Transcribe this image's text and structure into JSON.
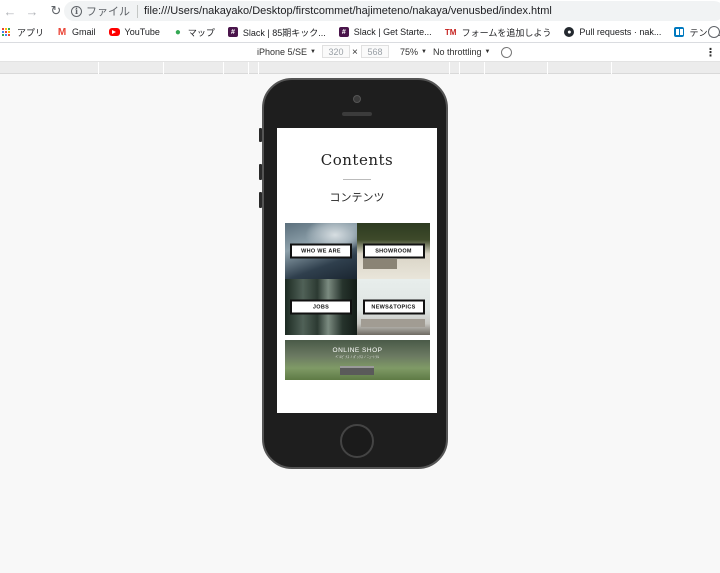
{
  "browser": {
    "scheme_label": "ファイル",
    "url": "file:///Users/nakayako/Desktop/firstcommet/hajimeteno/nakaya/venusbed/index.html"
  },
  "bookmarks": [
    {
      "label": "アプリ",
      "icon": "apps-grid-icon"
    },
    {
      "label": "Gmail",
      "icon": "gmail-icon"
    },
    {
      "label": "YouTube",
      "icon": "youtube-icon"
    },
    {
      "label": "マップ",
      "icon": "maps-pin-icon"
    },
    {
      "label": "Slack | 85期キック...",
      "icon": "slack-icon"
    },
    {
      "label": "Slack | Get Starte...",
      "icon": "slack-icon"
    },
    {
      "label": "フォームを追加しよう",
      "icon": "tm-icon",
      "icon_text": "TM"
    },
    {
      "label": "Pull requests · nak...",
      "icon": "github-icon"
    },
    {
      "label": "テンプレート | Trello",
      "icon": "trello-icon"
    }
  ],
  "device_toolbar": {
    "device": "iPhone 5/SE",
    "width": "320",
    "times": "×",
    "height": "568",
    "zoom": "75%",
    "throttling": "No throttling"
  },
  "site": {
    "title": "Contents",
    "subtitle": "コンテンツ",
    "tiles": {
      "who_we_are": "WHO WE ARE",
      "showroom": "SHOWROOM",
      "jobs": "JOBS",
      "news_topics": "NEWS&TOPICS",
      "online_shop": "ONLINE SHOP",
      "online_shop_sub": "ﾍﾞﾙﾋﾞﾅｽ / ﾎﾞｯｸｽ / ﾆｭｰﾄﾗﾙ"
    }
  },
  "colors": {
    "page_background": "#f8f8f8",
    "phone_body": "#1e1e1e",
    "omnibox": "#f1f3f4"
  }
}
